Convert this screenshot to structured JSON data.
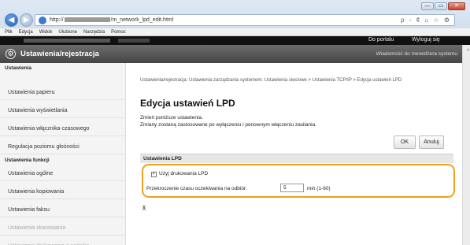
{
  "browser": {
    "url_prefix": "http://",
    "url_suffix": "/m_network_lpd_edit.html",
    "tools": "ρ - ¢  ⌂ ☆ ⚙",
    "menu": [
      "Plik",
      "Edycja",
      "Widok",
      "Ulubione",
      "Narzędzia",
      "Pomoc"
    ],
    "win_min": "—",
    "win_max": "▭",
    "win_close": "✕",
    "back_glyph": "◀",
    "fwd_glyph": "▶"
  },
  "top": {
    "portal_link": "Do portalu",
    "logout_link": "Wyloguj się",
    "app_icon": "⚙",
    "app_title": "Ustawienia/rejestracja",
    "manager_link": "Wiadomość do menedżera systemu"
  },
  "sidebar": {
    "section1": "Ustawienia",
    "items1": [
      "Ustawienia papieru",
      "Ustawienia wyświetlania",
      "Ustawienia włącznika czasowego",
      "Regulacja poziomu głośności"
    ],
    "section2": "Ustawienia funkcji",
    "items2": [
      "Ustawienia ogólne",
      "Ustawienia kopiowania",
      "Ustawienia faksu",
      "Ustawienia skanowania",
      "Ustawienia drukowania z nośnika"
    ]
  },
  "main": {
    "breadcrumb": "Ustawienia/rejestracja: Ustawienia zarządzania systemem: Ustawienia sieciowe > Ustawienia TCP/IP > Edycja ustawień LPD",
    "title": "Edycja ustawień LPD",
    "desc1": "Zmień poniższe ustawienia.",
    "desc2": "Zmiany zostaną zastosowane po wyłączeniu i ponownym włączeniu zasilania.",
    "ok": "OK",
    "cancel": "Anuluj",
    "section": "Ustawienia LPD",
    "use_lpd_label": "Użyj drukowania LPD",
    "timeout_label": "Przekroczenie czasu oczekiwania na odbiór:",
    "timeout_value": "5",
    "timeout_unit": "min (1-60)",
    "to_top": "⊼"
  },
  "colors": {
    "highlight": "#f0a020",
    "appbar": "#555555"
  }
}
